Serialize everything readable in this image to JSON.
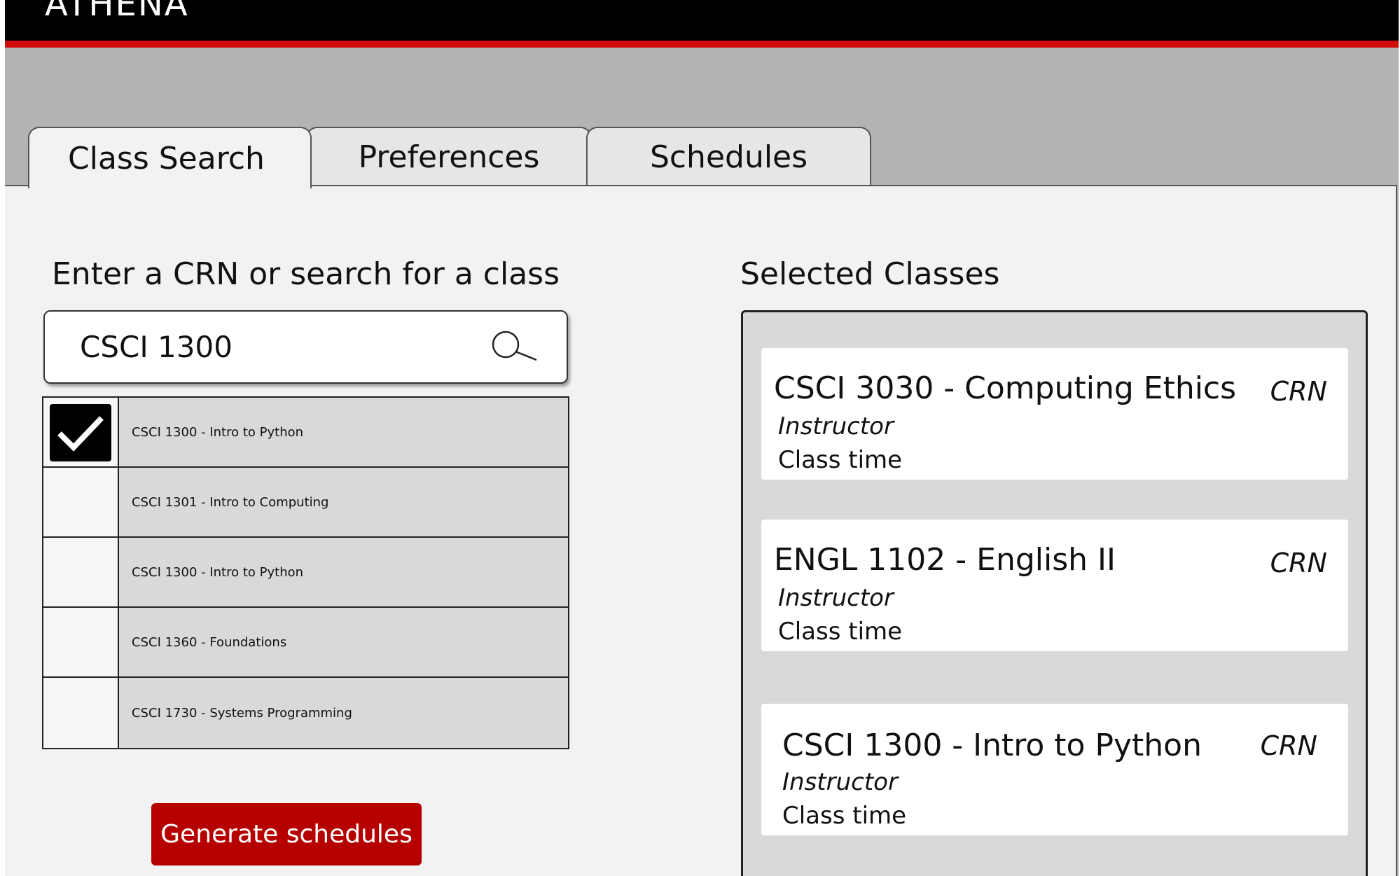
{
  "app": {
    "title": "ATHENA"
  },
  "tabs": [
    {
      "label": "Class Search",
      "active": true
    },
    {
      "label": "Preferences",
      "active": false
    },
    {
      "label": "Schedules",
      "active": false
    }
  ],
  "search": {
    "label": "Enter a CRN or search for a class",
    "value": "CSCI 1300",
    "icon": "search-icon"
  },
  "results": [
    {
      "label": "CSCI 1300 - Intro to Python",
      "checked": true
    },
    {
      "label": "CSCI 1301 - Intro to Computing",
      "checked": false
    },
    {
      "label": "CSCI 1300 - Intro to Python",
      "checked": false
    },
    {
      "label": "CSCI 1360 - Foundations",
      "checked": false
    },
    {
      "label": "CSCI 1730 - Systems Programming",
      "checked": false
    }
  ],
  "generate_button": {
    "label": "Generate schedules"
  },
  "selected": {
    "label": "Selected Classes",
    "classes": [
      {
        "title": "CSCI 3030 - Computing Ethics",
        "crn": "CRN",
        "instructor": "Instructor",
        "time": "Class time"
      },
      {
        "title": "ENGL 1102 - English II",
        "crn": "CRN",
        "instructor": "Instructor",
        "time": "Class time"
      },
      {
        "title": "CSCI 1300 - Intro to Python",
        "crn": "CRN",
        "instructor": "Instructor",
        "time": "Class time"
      }
    ]
  },
  "colors": {
    "accent_red": "#d10a0a",
    "button_red": "#b60000",
    "header_black": "#000000",
    "chrome_gray": "#b3b3b3"
  }
}
